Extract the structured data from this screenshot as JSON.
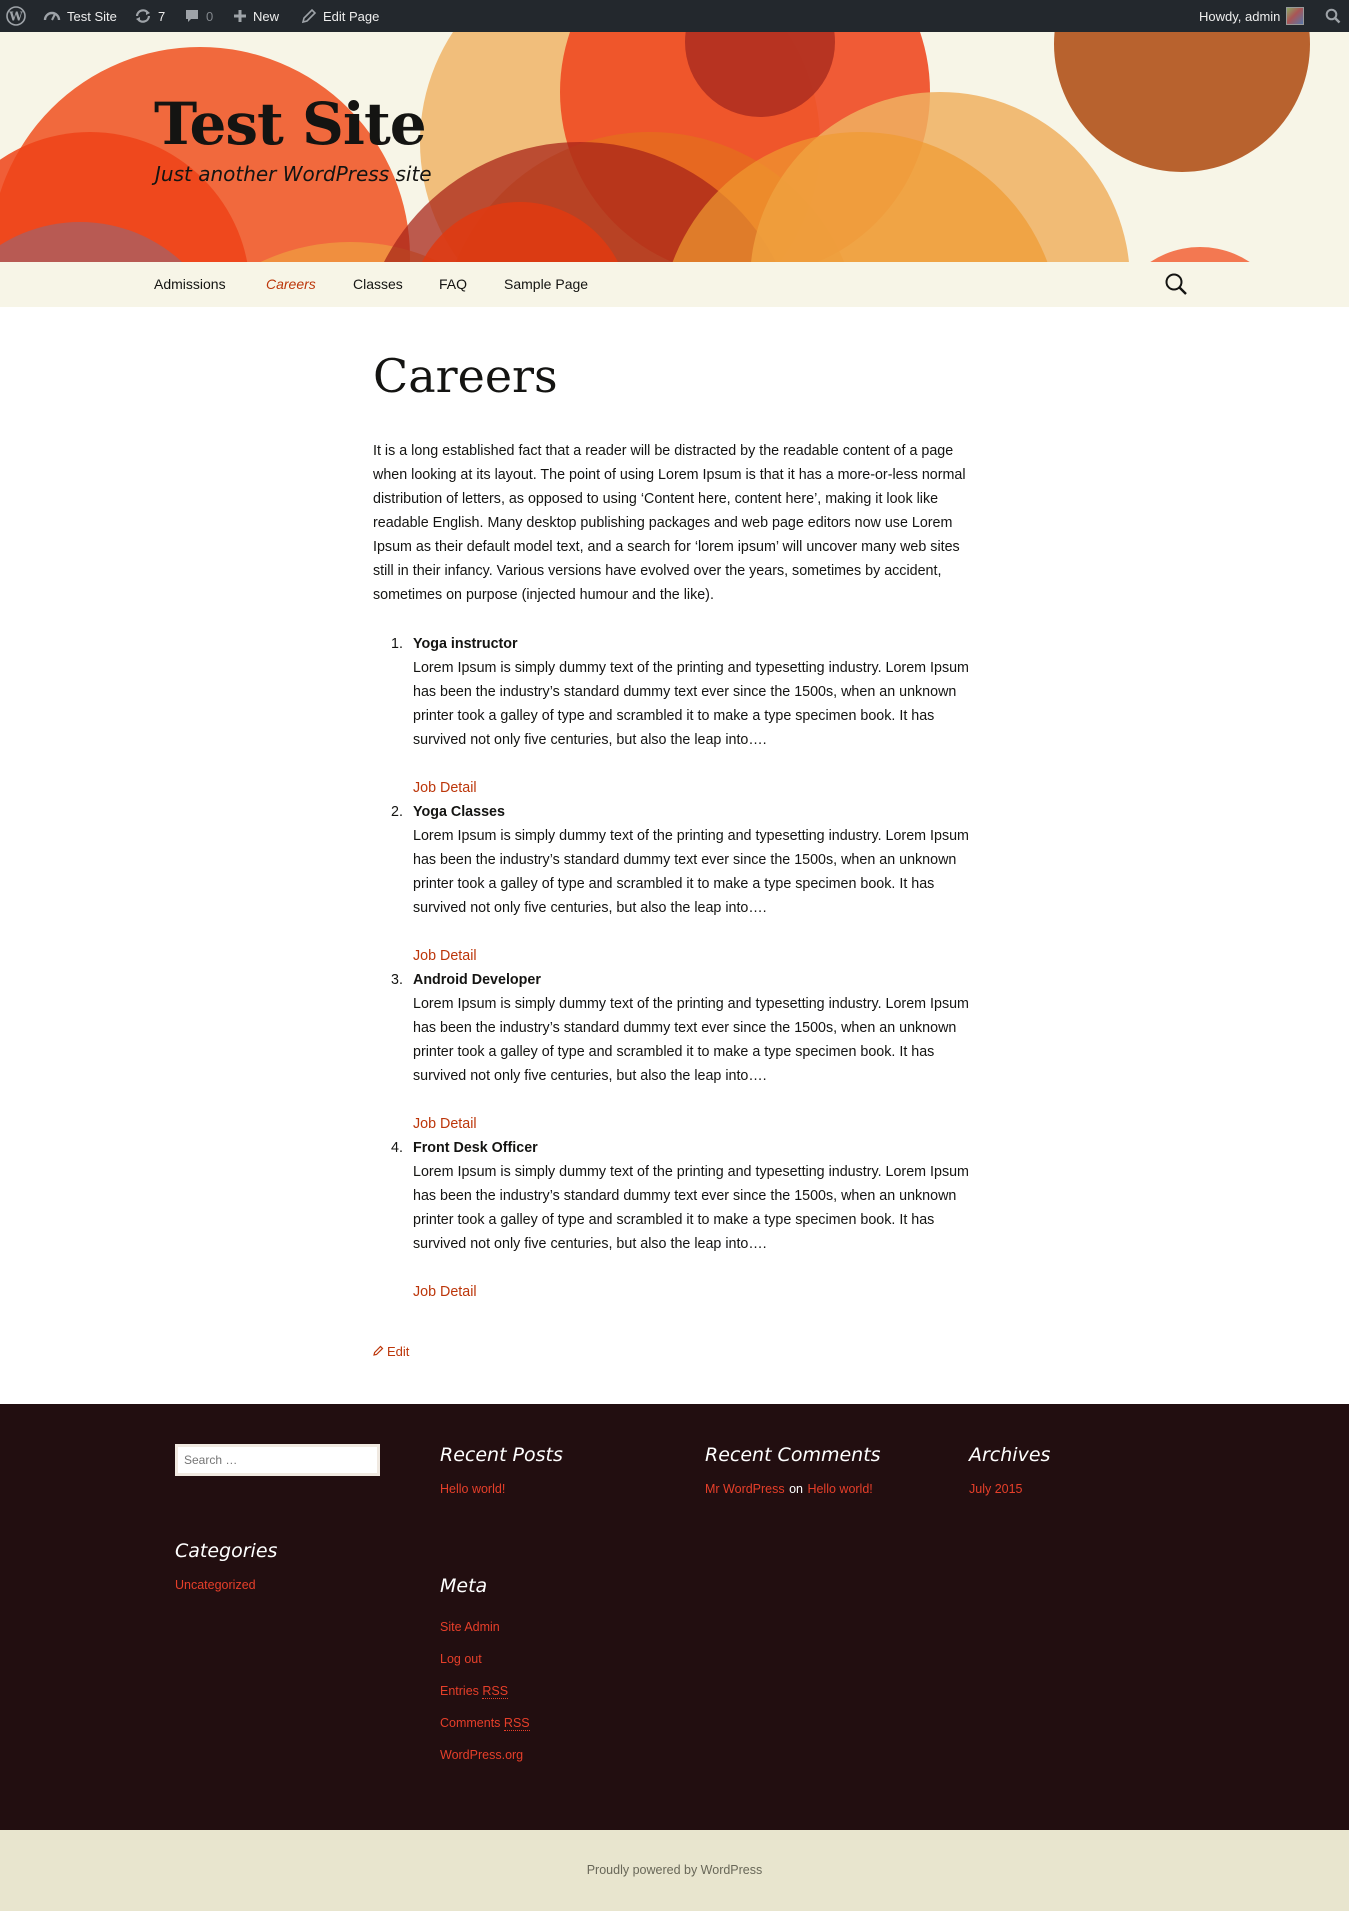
{
  "admin_bar": {
    "site_name": "Test Site",
    "updates_count": "7",
    "comments_count": "0",
    "new_label": "New",
    "edit_page_label": "Edit Page",
    "howdy": "Howdy, admin"
  },
  "header": {
    "site_title": "Test Site",
    "site_description": "Just another WordPress site"
  },
  "nav": {
    "items": [
      {
        "label": "Admissions",
        "current": false
      },
      {
        "label": "Careers",
        "current": true
      },
      {
        "label": "Classes",
        "current": false
      },
      {
        "label": "FAQ",
        "current": false
      },
      {
        "label": "Sample Page",
        "current": false
      }
    ]
  },
  "page": {
    "title": "Careers",
    "intro": "It is a long established fact that a reader will be distracted by the readable content of a page when looking at its layout. The point of using Lorem Ipsum is that it has a more-or-less normal distribution of letters, as opposed to using ‘Content here, content here’, making it look like readable English. Many desktop publishing packages and web page editors now use Lorem Ipsum as their default model text, and a search for ‘lorem ipsum’ will uncover many web sites still in their infancy. Various versions have evolved over the years, sometimes by accident, sometimes on purpose (injected humour and the like).",
    "jobs": [
      {
        "num": "1.",
        "title": "Yoga instructor",
        "desc": "Lorem Ipsum is simply dummy text of the printing and typesetting industry. Lorem Ipsum has been the industry’s standard dummy text ever since the 1500s, when an unknown printer took a galley of type and scrambled it to make a type specimen book. It has survived not only five centuries, but also the leap into….",
        "link": "Job Detail"
      },
      {
        "num": "2.",
        "title": "Yoga Classes",
        "desc": "Lorem Ipsum is simply dummy text of the printing and typesetting industry. Lorem Ipsum has been the industry’s standard dummy text ever since the 1500s, when an unknown printer took a galley of type and scrambled it to make a type specimen book. It has survived not only five centuries, but also the leap into….",
        "link": "Job Detail"
      },
      {
        "num": "3.",
        "title": "Android Developer",
        "desc": "Lorem Ipsum is simply dummy text of the printing and typesetting industry. Lorem Ipsum has been the industry’s standard dummy text ever since the 1500s, when an unknown printer took a galley of type and scrambled it to make a type specimen book. It has survived not only five centuries, but also the leap into….",
        "link": "Job Detail"
      },
      {
        "num": "4.",
        "title": "Front Desk Officer",
        "desc": "Lorem Ipsum is simply dummy text of the printing and typesetting industry. Lorem Ipsum has been the industry’s standard dummy text ever since the 1500s, when an unknown printer took a galley of type and scrambled it to make a type specimen book. It has survived not only five centuries, but also the leap into….",
        "link": "Job Detail"
      }
    ],
    "edit_label": "Edit"
  },
  "footer": {
    "search_placeholder": "Search …",
    "recent_posts": {
      "title": "Recent Posts",
      "items": [
        "Hello world!"
      ]
    },
    "recent_comments": {
      "title": "Recent Comments",
      "author": "Mr WordPress",
      "on": "on",
      "post": "Hello world!"
    },
    "archives": {
      "title": "Archives",
      "items": [
        "July 2015"
      ]
    },
    "categories": {
      "title": "Categories",
      "items": [
        "Uncategorized"
      ]
    },
    "meta": {
      "title": "Meta",
      "site_admin": "Site Admin",
      "log_out": "Log out",
      "entries": "Entries",
      "comments": "Comments",
      "rss": "RSS",
      "wordpress_org": "WordPress.org"
    },
    "powered_by": "Proudly powered by WordPress"
  },
  "colors": {
    "accent": "#bc360a",
    "footer_link": "#e63f2a",
    "footer_bg": "#220e10",
    "header_bg": "#f7f5e7",
    "adminbar_bg": "#23282d"
  }
}
